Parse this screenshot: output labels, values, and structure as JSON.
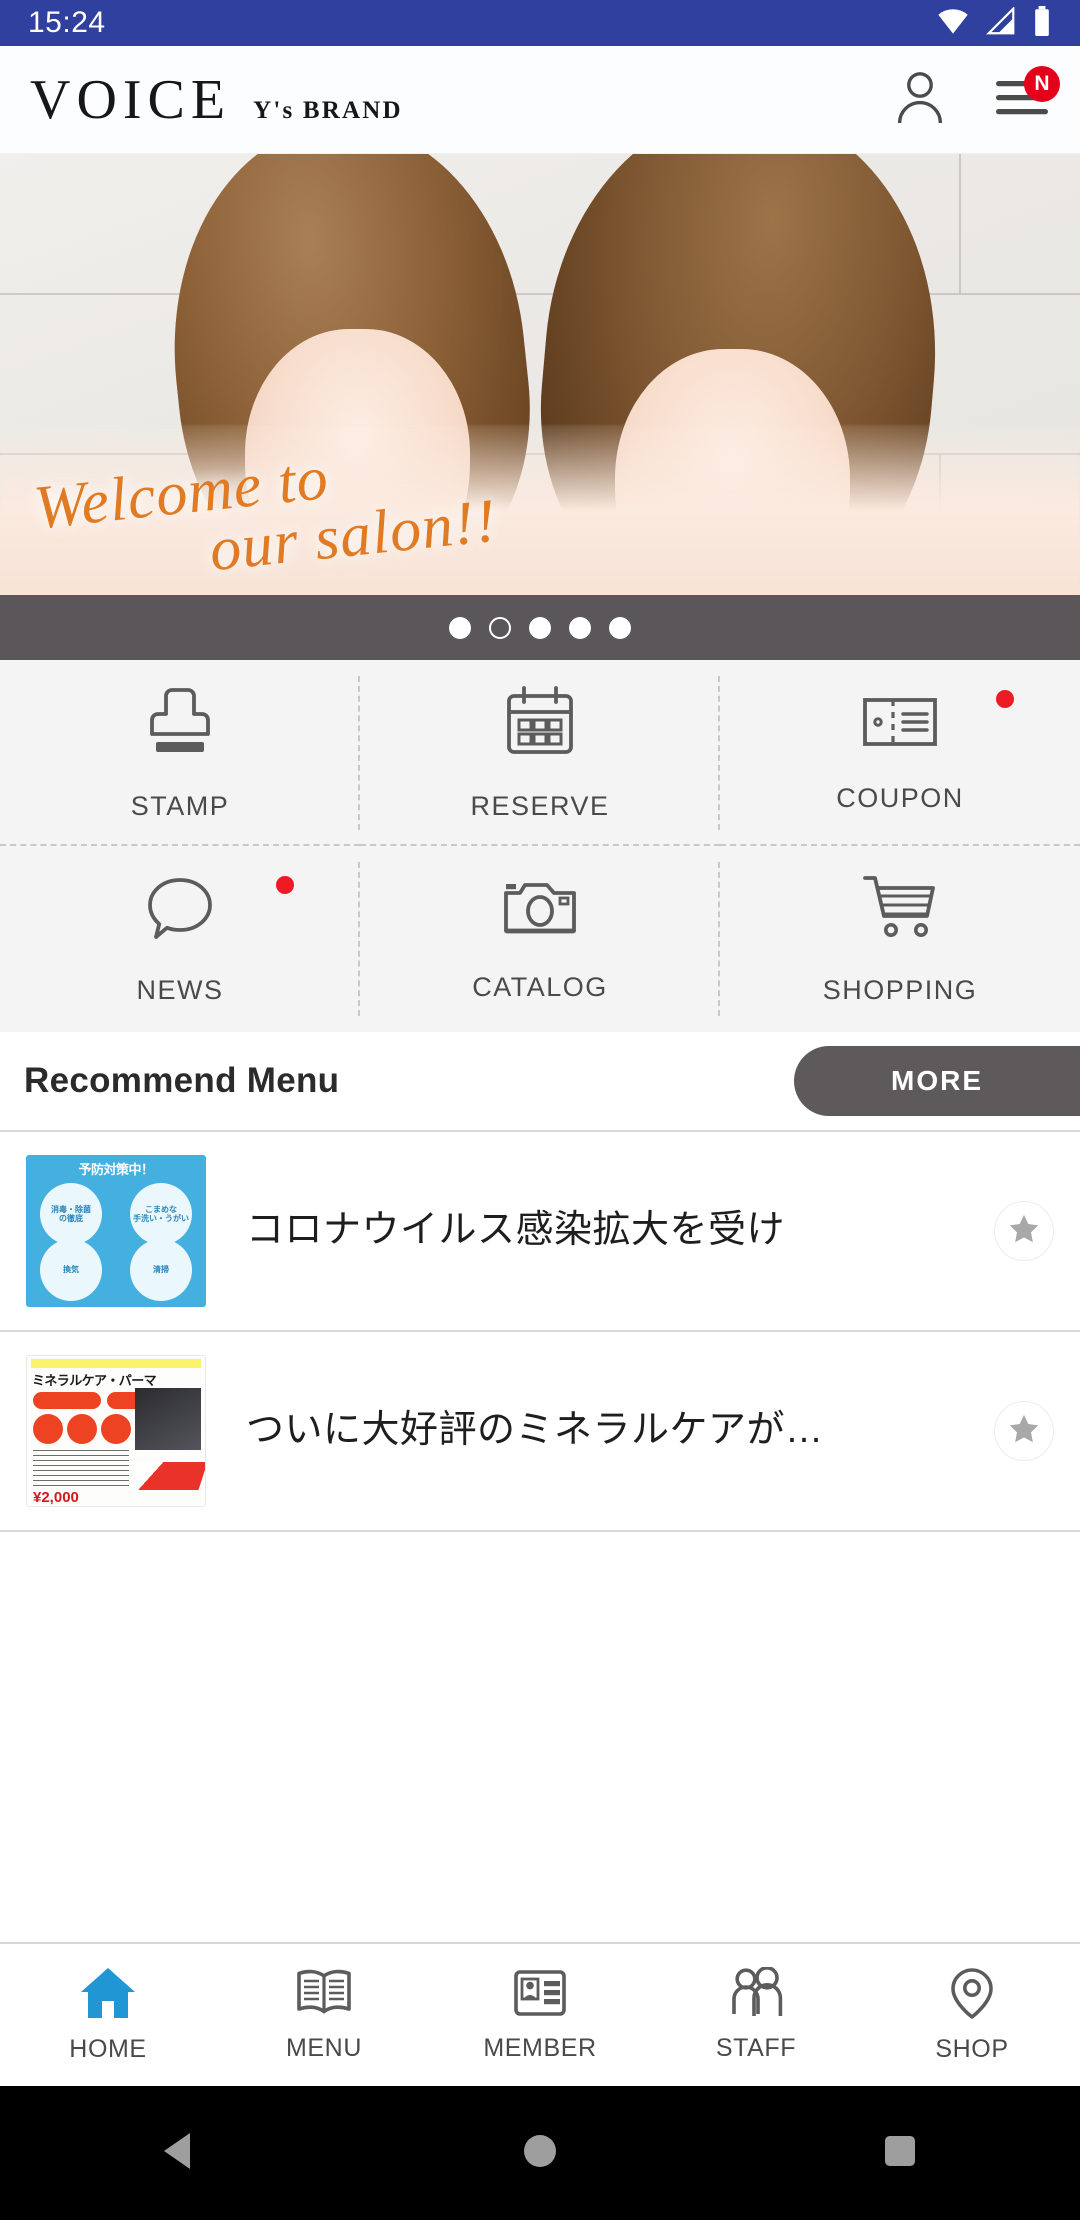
{
  "status_bar": {
    "time": "15:24",
    "background": "#2f409e",
    "icons": [
      "wifi-icon",
      "signal-icon",
      "battery-icon"
    ]
  },
  "header": {
    "logo_main": "VOICE",
    "logo_sub": "Y's BRAND",
    "account_icon": "person-icon",
    "menu_icon": "hamburger-menu-icon",
    "menu_badge": "N",
    "badge_color": "#e4001b"
  },
  "hero": {
    "caption_line1": "Welcome to",
    "caption_line2": "our salon!!",
    "caption_color": "#e07b24"
  },
  "carousel": {
    "total_dots": 5,
    "active_index": 1,
    "dots": [
      "filled",
      "hollow",
      "filled",
      "filled",
      "filled"
    ],
    "background": "#5b5659"
  },
  "quick_grid": {
    "items": [
      {
        "label": "STAMP",
        "icon": "stamp-icon",
        "badge": false
      },
      {
        "label": "RESERVE",
        "icon": "calendar-icon",
        "badge": false
      },
      {
        "label": "COUPON",
        "icon": "ticket-icon",
        "badge": true
      },
      {
        "label": "NEWS",
        "icon": "speech-bubble-icon",
        "badge": true
      },
      {
        "label": "CATALOG",
        "icon": "camera-icon",
        "badge": false
      },
      {
        "label": "SHOPPING",
        "icon": "shopping-cart-icon",
        "badge": false
      }
    ],
    "badge_color": "#ed1c24"
  },
  "recommend": {
    "section_title": "Recommend Menu",
    "more_label": "MORE",
    "more_button_color": "#5e5a5c",
    "items": [
      {
        "title": "コロナウイルス感染拡大を受け",
        "thumb_kind": "corona-poster",
        "thumb_heading": "予防対策中！",
        "thumb_bubbles": [
          "消毒・除菌\nの徹底",
          "こまめな\n手洗い・うがい",
          "",
          ""
        ],
        "favorite_icon": "star-icon"
      },
      {
        "title": "ついに大好評のミネラルケアが…",
        "thumb_kind": "perm-poster",
        "thumb_heading": "ミネラルケア・パーマ",
        "thumb_price": "¥2,000",
        "favorite_icon": "star-icon"
      }
    ]
  },
  "bottom_nav": {
    "active": "HOME",
    "active_color": "#2196d4",
    "items": [
      {
        "label": "HOME",
        "icon": "home-icon"
      },
      {
        "label": "MENU",
        "icon": "book-icon"
      },
      {
        "label": "MEMBER",
        "icon": "id-card-icon"
      },
      {
        "label": "STAFF",
        "icon": "people-icon"
      },
      {
        "label": "SHOP",
        "icon": "map-pin-icon"
      }
    ]
  },
  "system_nav": {
    "back": "back-triangle-icon",
    "home": "home-circle-icon",
    "recents": "recents-square-icon"
  }
}
